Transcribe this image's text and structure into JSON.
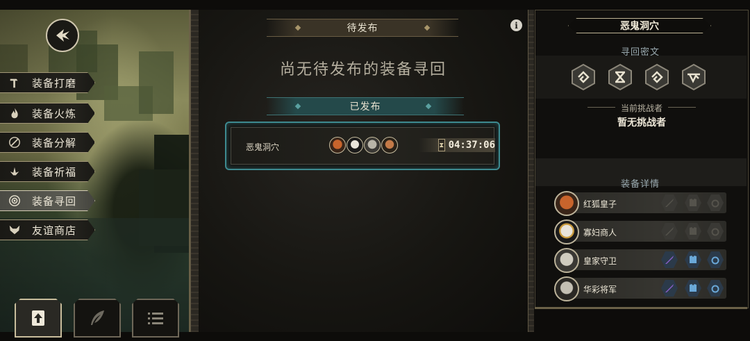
{
  "left_menu": {
    "items": [
      {
        "label": "装备打磨",
        "icon": "hammer-icon"
      },
      {
        "label": "装备火炼",
        "icon": "fire-icon"
      },
      {
        "label": "装备分解",
        "icon": "broken-blade-icon"
      },
      {
        "label": "装备祈福",
        "icon": "blessing-icon"
      },
      {
        "label": "装备寻回",
        "icon": "target-icon",
        "active": true
      },
      {
        "label": "友谊商店",
        "icon": "fox-face-icon"
      }
    ]
  },
  "bottom_buttons": [
    {
      "icon": "upload-icon",
      "active": true
    },
    {
      "icon": "feather-icon",
      "active": false
    },
    {
      "icon": "list-icon",
      "active": false
    }
  ],
  "center": {
    "pending_banner": "待发布",
    "empty_message": "尚无待发布的装备寻回",
    "published_banner": "已发布",
    "quest": {
      "name": "恶鬼洞穴",
      "timer": "04:37:06",
      "avatars": [
        "red-fox-avatar",
        "widow-merchant-avatar",
        "royal-guard-avatar",
        "colorful-general-avatar"
      ]
    }
  },
  "right_panel": {
    "title": "恶鬼洞穴",
    "rune_label": "寻回密文",
    "runes": [
      "rune-spiral-icon",
      "rune-cross-icon",
      "rune-spiral-icon",
      "rune-zigzag-icon"
    ],
    "challenger_label": "当前挑战者",
    "challenger_value": "暂无挑战者",
    "equipment_label": "装备详情",
    "equipment": [
      {
        "name": "红狐皇子",
        "avatar": "red-fox-avatar",
        "weapon": false,
        "armor": false,
        "ring": false
      },
      {
        "name": "寡妇商人",
        "avatar": "widow-merchant-avatar",
        "weapon": false,
        "armor": false,
        "ring": false
      },
      {
        "name": "皇家守卫",
        "avatar": "royal-guard-avatar",
        "weapon": true,
        "armor": true,
        "ring": true
      },
      {
        "name": "华彩将军",
        "avatar": "colorful-general-avatar",
        "weapon": true,
        "armor": true,
        "ring": true
      }
    ]
  },
  "colors": {
    "accent_teal": "#3d8a90",
    "gold_border": "#bdb394",
    "weapon_purple": "#8a5ec8",
    "armor_blue": "#6aa8d8"
  }
}
